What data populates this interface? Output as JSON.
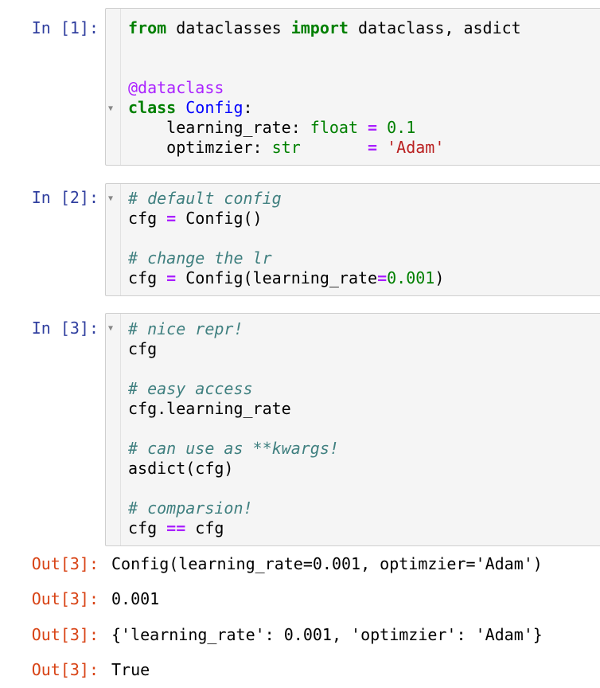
{
  "cells": [
    {
      "prompt": "In [1]:",
      "lines": [
        [
          {
            "t": "from",
            "c": "kw"
          },
          {
            "t": " dataclasses ",
            "c": ""
          },
          {
            "t": "import",
            "c": "kw"
          },
          {
            "t": " dataclass, asdict",
            "c": ""
          }
        ],
        [],
        [],
        [
          {
            "t": "@dataclass",
            "c": "deco"
          }
        ],
        [
          {
            "t": "class",
            "c": "kw"
          },
          {
            "t": " ",
            "c": ""
          },
          {
            "t": "Config",
            "c": "cls"
          },
          {
            "t": ":",
            "c": ""
          }
        ],
        [
          {
            "t": "    learning_rate: ",
            "c": ""
          },
          {
            "t": "float",
            "c": "bi"
          },
          {
            "t": " ",
            "c": ""
          },
          {
            "t": "=",
            "c": "op"
          },
          {
            "t": " ",
            "c": ""
          },
          {
            "t": "0.1",
            "c": "num"
          }
        ],
        [
          {
            "t": "    optimzier: ",
            "c": ""
          },
          {
            "t": "str",
            "c": "bi"
          },
          {
            "t": "       ",
            "c": ""
          },
          {
            "t": "=",
            "c": "op"
          },
          {
            "t": " ",
            "c": ""
          },
          {
            "t": "'Adam'",
            "c": "str"
          }
        ]
      ]
    },
    {
      "prompt": "In [2]:",
      "lines": [
        [
          {
            "t": "# default config",
            "c": "cm"
          }
        ],
        [
          {
            "t": "cfg ",
            "c": ""
          },
          {
            "t": "=",
            "c": "op"
          },
          {
            "t": " Config()",
            "c": ""
          }
        ],
        [],
        [
          {
            "t": "# change the lr",
            "c": "cm"
          }
        ],
        [
          {
            "t": "cfg ",
            "c": ""
          },
          {
            "t": "=",
            "c": "op"
          },
          {
            "t": " Config(learning_rate",
            "c": ""
          },
          {
            "t": "=",
            "c": "op"
          },
          {
            "t": "0.001",
            "c": "num"
          },
          {
            "t": ")",
            "c": ""
          }
        ]
      ]
    },
    {
      "prompt": "In [3]:",
      "lines": [
        [
          {
            "t": "# nice repr!",
            "c": "cm"
          }
        ],
        [
          {
            "t": "cfg",
            "c": ""
          }
        ],
        [],
        [
          {
            "t": "# easy access",
            "c": "cm"
          }
        ],
        [
          {
            "t": "cfg.learning_rate",
            "c": ""
          }
        ],
        [],
        [
          {
            "t": "# can use as **kwargs!",
            "c": "cm"
          }
        ],
        [
          {
            "t": "asdict(cfg)",
            "c": ""
          }
        ],
        [],
        [
          {
            "t": "# comparsion!",
            "c": "cm"
          }
        ],
        [
          {
            "t": "cfg ",
            "c": ""
          },
          {
            "t": "==",
            "c": "op"
          },
          {
            "t": " cfg",
            "c": ""
          }
        ]
      ]
    }
  ],
  "outputs": [
    {
      "prompt": "Out[3]:",
      "text": "Config(learning_rate=0.001, optimzier='Adam')"
    },
    {
      "prompt": "Out[3]:",
      "text": "0.001"
    },
    {
      "prompt": "Out[3]:",
      "text": "{'learning_rate': 0.001, 'optimzier': 'Adam'}"
    },
    {
      "prompt": "Out[3]:",
      "text": "True"
    }
  ],
  "icons": {
    "fold": "fold-arrow-icon"
  },
  "colors": {
    "in_prompt": "#303f9f",
    "out_prompt": "#d84315",
    "cell_bg": "#f5f5f5"
  }
}
